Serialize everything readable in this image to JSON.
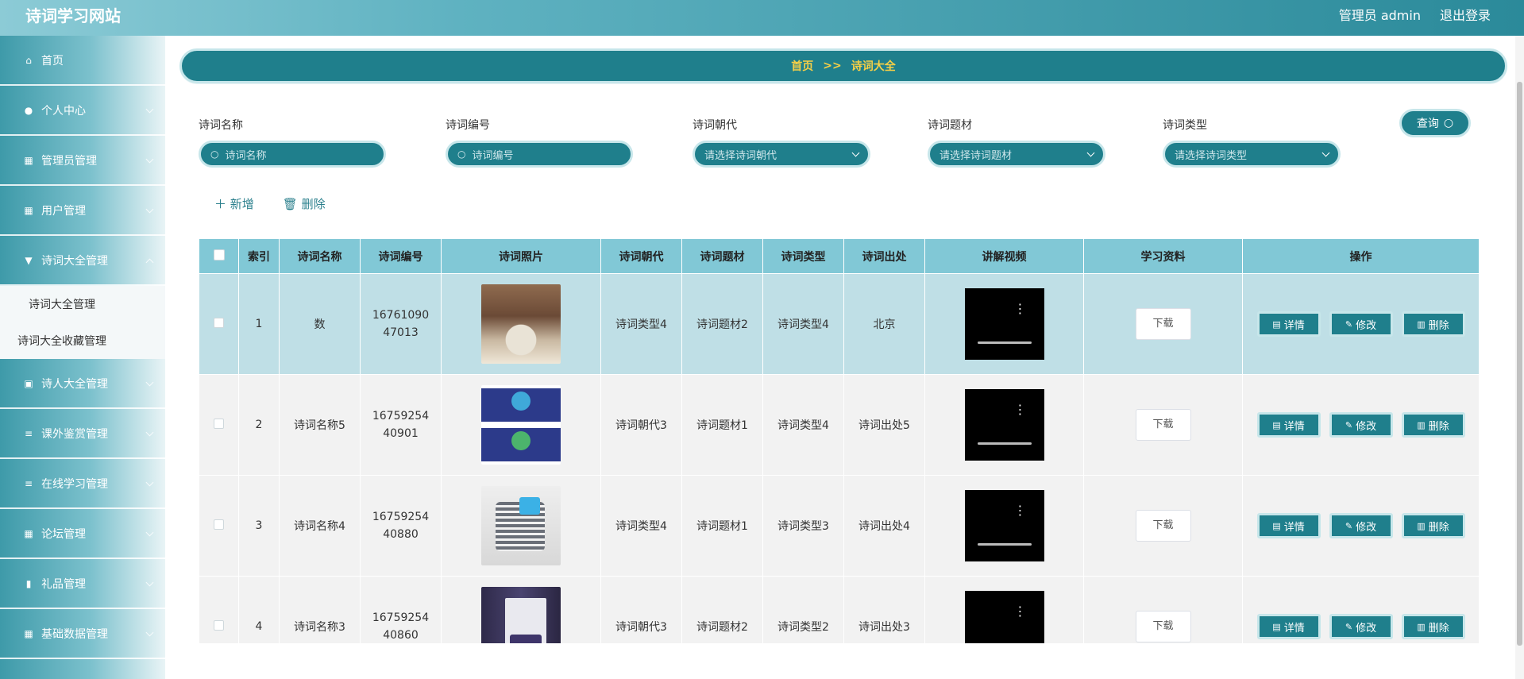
{
  "header": {
    "site_title": "诗词学习网站",
    "admin_label": "管理员 admin",
    "logout_label": "退出登录"
  },
  "sidebar": {
    "items": [
      {
        "label": "首页",
        "icon": "home-icon",
        "glyph": "⌂"
      },
      {
        "label": "个人中心",
        "icon": "user-icon",
        "glyph": "●"
      },
      {
        "label": "管理员管理",
        "icon": "grid-icon",
        "glyph": "▦"
      },
      {
        "label": "用户管理",
        "icon": "grid-icon",
        "glyph": "▦"
      },
      {
        "label": "诗词大全管理",
        "icon": "funnel-icon",
        "glyph": "▼"
      },
      {
        "label": "诗人大全管理",
        "icon": "clipboard-icon",
        "glyph": "▣"
      },
      {
        "label": "课外鉴赏管理",
        "icon": "list-icon",
        "glyph": "≡"
      },
      {
        "label": "在线学习管理",
        "icon": "list-icon",
        "glyph": "≡"
      },
      {
        "label": "论坛管理",
        "icon": "grid-icon",
        "glyph": "▦"
      },
      {
        "label": "礼品管理",
        "icon": "bar-chart-icon",
        "glyph": "▮"
      },
      {
        "label": "基础数据管理",
        "icon": "grid-icon",
        "glyph": "▦"
      }
    ],
    "submenu": [
      "诗词大全管理",
      "诗词大全收藏管理"
    ]
  },
  "breadcrumb": {
    "home": "首页",
    "sep": ">>",
    "current": "诗词大全"
  },
  "search": {
    "name_label": "诗词名称",
    "name_placeholder": "诗词名称",
    "code_label": "诗词编号",
    "code_placeholder": "诗词编号",
    "dynasty_label": "诗词朝代",
    "dynasty_placeholder": "请选择诗词朝代",
    "subject_label": "诗词题材",
    "subject_placeholder": "请选择诗词题材",
    "type_label": "诗词类型",
    "type_placeholder": "请选择诗词类型",
    "query_label": "查询"
  },
  "actions": {
    "add_label": "新增",
    "delete_label": "删除"
  },
  "table": {
    "headers": [
      "索引",
      "诗词名称",
      "诗词编号",
      "诗词照片",
      "诗词朝代",
      "诗词题材",
      "诗词类型",
      "诗词出处",
      "讲解视频",
      "学习资料",
      "操作"
    ],
    "download_label": "下载",
    "detail_label": "详情",
    "edit_label": "修改",
    "delete_label": "删除",
    "rows": [
      {
        "index": "1",
        "name": "数",
        "code": "1676109047013",
        "dynasty": "诗词类型4",
        "subject": "诗词题材2",
        "type": "诗词类型4",
        "source": "北京"
      },
      {
        "index": "2",
        "name": "诗词名称5",
        "code": "1675925440901",
        "dynasty": "诗词朝代3",
        "subject": "诗词题材1",
        "type": "诗词类型4",
        "source": "诗词出处5"
      },
      {
        "index": "3",
        "name": "诗词名称4",
        "code": "1675925440880",
        "dynasty": "诗词类型4",
        "subject": "诗词题材1",
        "type": "诗词类型3",
        "source": "诗词出处4"
      },
      {
        "index": "4",
        "name": "诗词名称3",
        "code": "1675925440860",
        "dynasty": "诗词朝代3",
        "subject": "诗词题材2",
        "type": "诗词类型2",
        "source": "诗词出处3"
      }
    ]
  },
  "colors": {
    "primary": "#1f7f8c",
    "header_bg": "#81c8d6",
    "breadcrumb_text": "#f7d046",
    "row_highlight": "#bfdfe6"
  }
}
